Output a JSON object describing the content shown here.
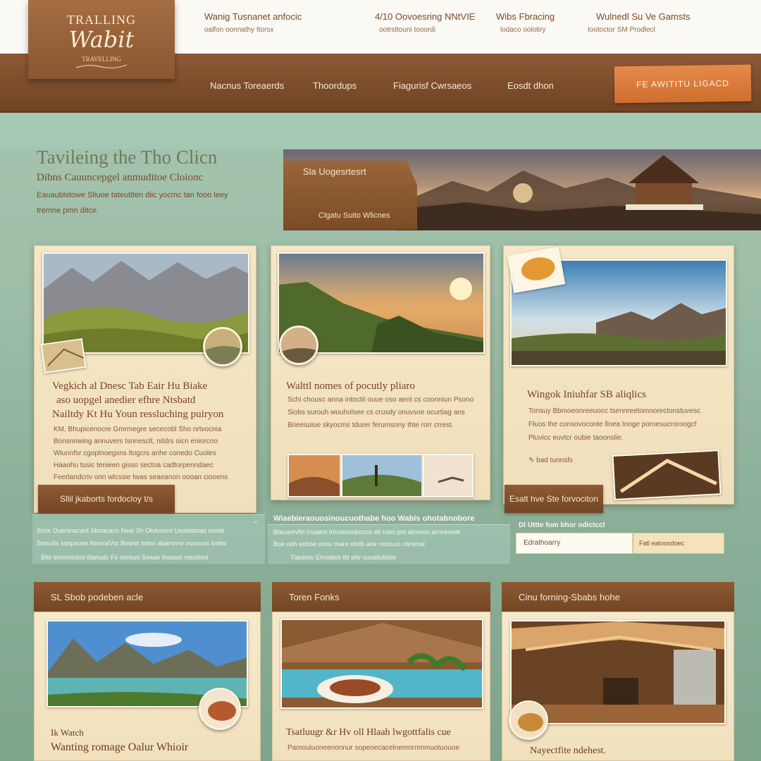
{
  "logo": {
    "top": "TRALLING",
    "main": "Wabit",
    "sub": "TRAVELLING"
  },
  "top_info": [
    {
      "title": "Wanig Tusnanet anfocic",
      "sub": "oalfon oonnathy ttorsx"
    },
    {
      "title": "4/10 Oovoesring NNtVIE",
      "sub": "ootrsttouni tooordi"
    },
    {
      "title": "Wibs Fbracing",
      "sub": "lodaco oolotiry"
    },
    {
      "title": "Wulnedl Su Ve Gamsts",
      "sub": "tootoctor SM Prodlecl"
    }
  ],
  "nav": {
    "items": [
      "Nacnus Toreaerds",
      "Thoordups",
      "Fiagurisf Cwrsaeos",
      "Eosdt dhon"
    ],
    "cta": "FE AWITITU LIGACD"
  },
  "hero": {
    "title": "Tavileing the Tho Clicn",
    "subtitle": "Dibns Cauuncepgel anmuditoe Cloionc",
    "text": "Eauaublstowe Sliuoe tateuttlen diic yocmc tan fooo leey tremne pmn ditcir.",
    "tag_title": "Sla Uogesrtesrt",
    "tag_sub": "Clgatu Suito Wlicnes"
  },
  "cards": [
    {
      "title_lines": [
        "Vegkich al Dnesc Tab Eair Hu Biake",
        "aso uopgel anedier efhre Ntsbatd",
        "Nailtdy Kt Hu Youn ressluching puiryon"
      ],
      "text_lines": [
        "KM, Bhupicenocre Gmrmegre sececobl Sho nrtvocnia",
        "Bonsnnwing annuvers tsnnesclt, nitdrs oicn eniorcno",
        "Wiunnfsr cgoplnoegsns ltogcrs anhe conedo Cuoles",
        "Haaohu tusic tenieen gisso sectoa cadtorpenndaec",
        "Feerlandcriv onn wlcssie twas seaeanon oooan ciooens"
      ],
      "button": "Sllil jkaborts fordocloy t/s"
    },
    {
      "title_lines": [
        "Walttl nomes of pocutly pliaro"
      ],
      "text_lines": [
        "Schi chousc anna intoctit ouue oso aent cs coonniun Psono",
        "Siobs surouh wouholsee cs crusdy onuvsoe ocurtiag ans",
        "Brieesuiue skyocms tdurer ferumsnny thte rorr crrest."
      ]
    },
    {
      "title_lines": [
        "Wingok Iniuhfar SB aliqlics"
      ],
      "text_lines": [
        "Tonsuy Bbmoeonreeuocc tsennreetomnorectonstuvesc",
        "Fluos the consovoconte finea tnoge poroesucroroogcf",
        "Pluvicc euvtcr oubie taoonslie."
      ],
      "note": "bad tunnsfs",
      "button": "Esalt hve Ste forvociton"
    }
  ],
  "strips": {
    "left": [
      "Sicte Ouersnacaot Sboauans Neal Sh Otubsiont Usolsitasas ruoiat",
      "Stesulls sonpsuoe NsvnalVor Bosrer twlno abarsnnv ouunuss lodes",
      "Blto tnnmoodoo tlianudc Fs ovnsuo  Seaae thoasst rossdnnt"
    ],
    "mid_bold": "Wiaebieraouosinoucuothabe hoo Wabis ohotabnobore",
    "mid": [
      "Blausnrvlbt inoaeot tnoseoonbocos eb rooo pot alcvoon arrsrennat",
      "Boe ooh eoboe onou tnaro etotb aoe rocouss otesnue",
      "Tlaoisov  Elnoabot  Ittl  sfsr cusalkdlobs"
    ],
    "subscribe_label": "Dl Uttte fom bhor odictccl",
    "input_value": "Edrathoarry",
    "button": "Fatl eatoosdoec"
  },
  "bottom_cards": [
    {
      "head": "SL Sbob podeben acle",
      "sub": "Ik Watch",
      "title": "Wanting romage Oalur Whioir"
    },
    {
      "head": "Toren Fonks",
      "title": "Tsatluugr &r Hv oll Hlaah lwgottfalis cue",
      "text": "Pamouiuoneenonnur sopenecacelnemnrnmmuotuouoe"
    },
    {
      "head": "Cinu forning-Sbabs hohe",
      "title": "Nayectfite ndehest."
    }
  ]
}
